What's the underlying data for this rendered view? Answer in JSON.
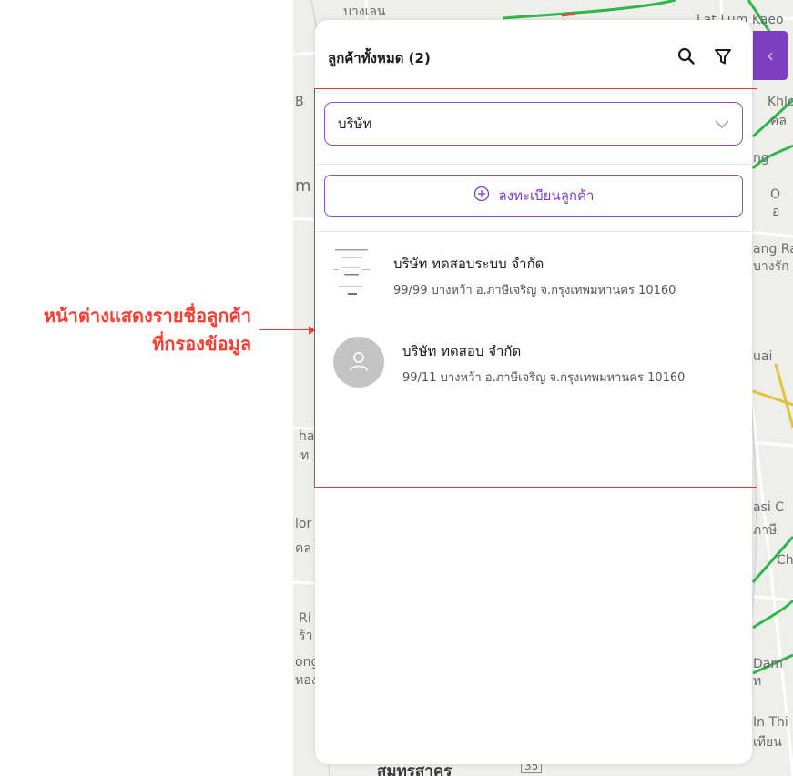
{
  "annotation": {
    "line1": "หน้าต่างแสดงรายชื่อลูกค้า",
    "line2": "ที่กรองข้อมูล",
    "color": "#ff3b30"
  },
  "map": {
    "labels": [
      "บางเลน",
      "Lat Lum Kaeo",
      "Khlo",
      "คล",
      "ng",
      "O",
      "อ",
      "ang Ra",
      "บางรัก",
      "uai",
      "ha",
      "ท",
      "asi C",
      "ภาษี",
      "Ch",
      "lor",
      "คล",
      "Ri",
      "ร้า",
      "ong",
      "ทอง",
      "Dam",
      "ท",
      "In Thi",
      "เทียน",
      "สมุทรสาคร",
      "35",
      "m",
      "B"
    ],
    "side_tab_icon": "chevron-left-icon",
    "accent": "#7d3fc0"
  },
  "panel": {
    "title": "ลูกค้าทั้งหมด (2)",
    "search_icon": "search-icon",
    "filter_icon": "filter-icon",
    "select": {
      "value": "บริษัท",
      "icon": "chevron-down-icon"
    },
    "register_button": {
      "label": "ลงทะเบียนลูกค้า",
      "icon": "plus-circle-icon"
    },
    "accent": "#8a4fd4",
    "customers": [
      {
        "name": "บริษัท ทดสอบระบบ จำกัด",
        "address": "99/99 บางหว้า อ.ภาษีเจริญ จ.กรุงเทพมหานคร 10160",
        "avatar": "company-logo"
      },
      {
        "name": "บริษัท ทดสอบ จำกัด",
        "address": "99/11 บางหว้า อ.ภาษีเจริญ จ.กรุงเทพมหานคร 10160",
        "avatar": "user-icon"
      }
    ]
  }
}
